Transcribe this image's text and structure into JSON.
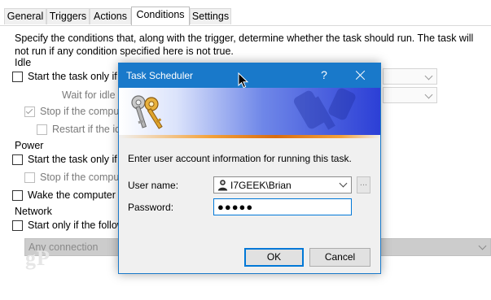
{
  "tabs": [
    "General",
    "Triggers",
    "Actions",
    "Conditions",
    "Settings"
  ],
  "active_tab": "Conditions",
  "conditions": {
    "description": "Specify the conditions that, along with the trigger, determine whether the task should run.  The task will not run  if any condition specified here is not true.",
    "idle": {
      "heading": "Idle",
      "start_only_if_idle": "Start the task only if t",
      "wait_for_idle": "Wait for idle f",
      "stop_if_computer": "Stop if the comput",
      "restart_if_idle": "Restart if the idl"
    },
    "power": {
      "heading": "Power",
      "start_only_if_ac": "Start the task only if t",
      "stop_if_battery": "Stop if the comput",
      "wake_computer": "Wake the computer t"
    },
    "network": {
      "heading": "Network",
      "start_only_if_network": "Start only if the follow",
      "connection_value": "Any connection"
    }
  },
  "watermark": "gP",
  "dialog": {
    "title": "Task Scheduler",
    "help_glyph": "?",
    "instruction": "Enter user account information for running this task.",
    "user_label": "User name:",
    "user_value": "I7GEEK\\Brian",
    "browse_label": "...",
    "password_label": "Password:",
    "password_value": "●●●●●",
    "ok_label": "OK",
    "cancel_label": "Cancel"
  },
  "colors": {
    "title_bar": "#1979ca",
    "focus_border": "#0078d7",
    "banner_dark": "#2c3fd6",
    "banner_accent": "#e07a1a"
  },
  "icons": [
    "keys-icon",
    "user-account-icon",
    "chevron-down-icon",
    "close-icon",
    "help-icon",
    "mouse-cursor-icon"
  ]
}
